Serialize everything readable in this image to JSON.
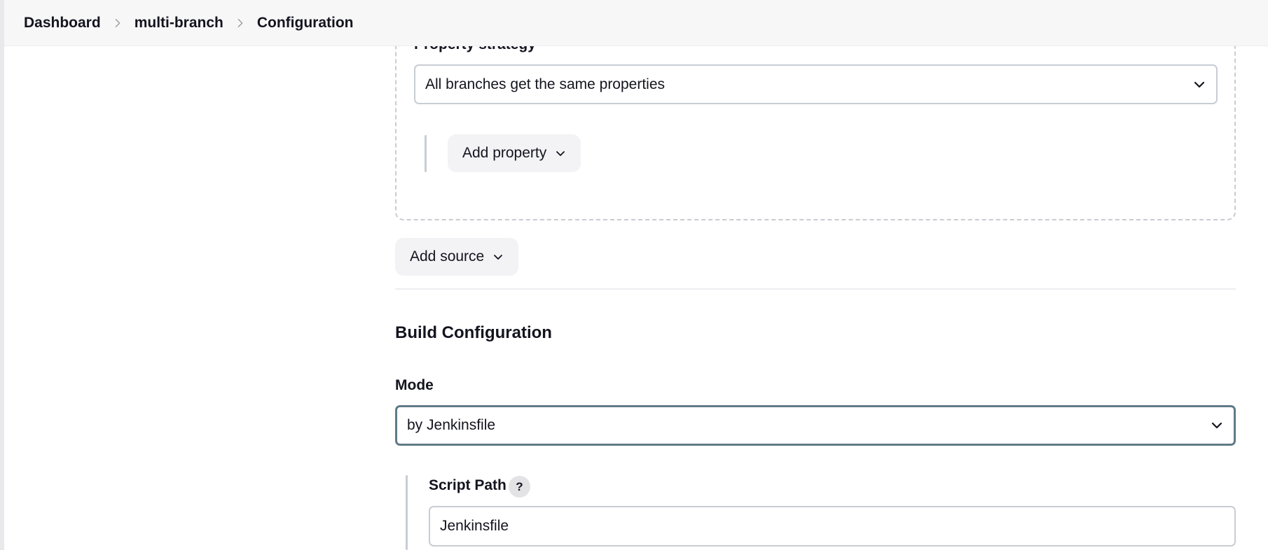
{
  "breadcrumb": {
    "items": [
      "Dashboard",
      "multi-branch",
      "Configuration"
    ]
  },
  "branch_source": {
    "property_strategy_label": "Property strategy",
    "property_strategy_value": "All branches get the same properties",
    "add_property_label": "Add property"
  },
  "add_source_label": "Add source",
  "build_configuration": {
    "title": "Build Configuration",
    "mode_label": "Mode",
    "mode_value": "by Jenkinsfile",
    "script_path_label": "Script Path",
    "script_path_help": "?",
    "script_path_value": "Jenkinsfile"
  },
  "icons": {
    "breadcrumb_separator": "chevron-right-icon",
    "dropdown": "chevron-down-icon"
  },
  "colors": {
    "mode_select_border": "#5f7a86",
    "button_bg": "#f3f3f5"
  }
}
